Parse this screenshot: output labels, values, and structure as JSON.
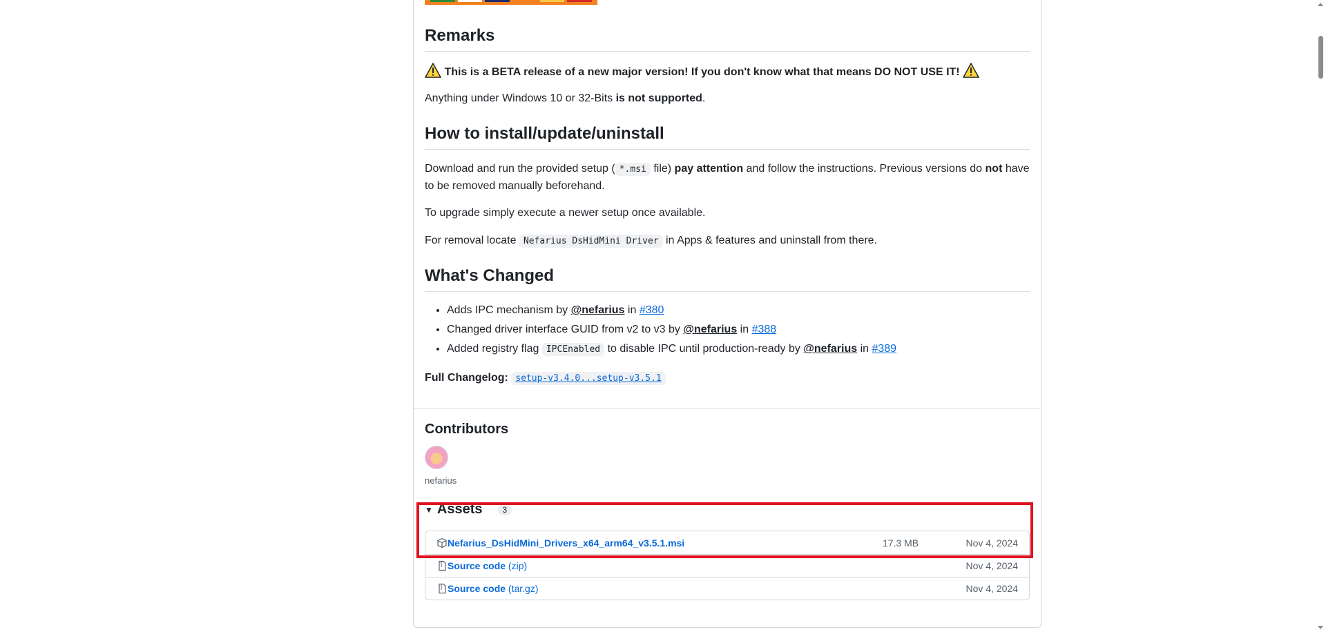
{
  "remarks": {
    "heading": "Remarks",
    "warning": "This is a BETA release of a new major version! If you don't know what that means DO NOT USE IT!",
    "support_prefix": "Anything under Windows 10 or 32-Bits ",
    "support_bold": "is not supported",
    "support_suffix": "."
  },
  "install": {
    "heading": "How to install/update/uninstall",
    "p1_a": "Download and run the provided setup (",
    "p1_code": "*.msi",
    "p1_b": " file) ",
    "p1_bold": "pay attention",
    "p1_c": " and follow the instructions. Previous versions do ",
    "p1_not": "not",
    "p1_d": " have to be removed manually beforehand.",
    "p2": "To upgrade simply execute a newer setup once available.",
    "p3_a": "For removal locate ",
    "p3_code": "Nefarius DsHidMini Driver",
    "p3_b": " in Apps & features and uninstall from there."
  },
  "changes": {
    "heading": "What's Changed",
    "items": [
      {
        "before": "Adds IPC mechanism by ",
        "user": "@nefarius",
        "in": " in ",
        "pr": "#380",
        "code": "",
        "after": ""
      },
      {
        "before": "Changed driver interface GUID from v2 to v3 by ",
        "user": "@nefarius",
        "in": " in ",
        "pr": "#388",
        "code": "",
        "after": ""
      },
      {
        "before": "Added registry flag ",
        "code": "IPCEnabled",
        "after": " to disable IPC until production-ready by ",
        "user": "@nefarius",
        "in": " in ",
        "pr": "#389"
      }
    ],
    "changelog_label": "Full Changelog:",
    "changelog_link": "setup-v3.4.0...setup-v3.5.1"
  },
  "contributors": {
    "heading": "Contributors",
    "name": "nefarius"
  },
  "assets": {
    "heading": "Assets",
    "count": "3",
    "rows": [
      {
        "name": "Nefarius_DsHidMini_Drivers_x64_arm64_v3.5.1.msi",
        "ext": "",
        "size": "17.3 MB",
        "date": "Nov 4, 2024",
        "icon": "package-icon"
      },
      {
        "name": "Source code",
        "ext": " (zip)",
        "size": "",
        "date": "Nov 4, 2024",
        "icon": "file-zip-icon"
      },
      {
        "name": "Source code",
        "ext": " (tar.gz)",
        "size": "",
        "date": "Nov 4, 2024",
        "icon": "file-zip-icon"
      }
    ]
  },
  "colors": {
    "link": "#0969da",
    "highlight": "#e0121f",
    "border": "#d0d7de"
  }
}
